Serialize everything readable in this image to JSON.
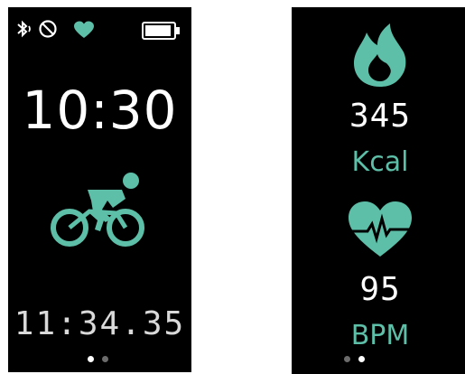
{
  "theme": {
    "accent": "#5dbfa8",
    "background": "#000000",
    "text": "#ffffff"
  },
  "screen_left": {
    "status_icons": [
      "bluetooth-icon",
      "do-not-disturb-icon",
      "heart-icon",
      "battery-icon"
    ],
    "time": "10:30",
    "activity_icon": "cycling-icon",
    "elapsed": "11:34.35",
    "page_dots": {
      "count": 2,
      "active_index": 0
    }
  },
  "screen_right": {
    "calories": {
      "icon": "flame-icon",
      "value": "345",
      "unit": "Kcal"
    },
    "heart_rate": {
      "icon": "heart-rate-icon",
      "value": "95",
      "unit": "BPM"
    },
    "page_dots": {
      "count": 2,
      "active_index": 1
    }
  }
}
